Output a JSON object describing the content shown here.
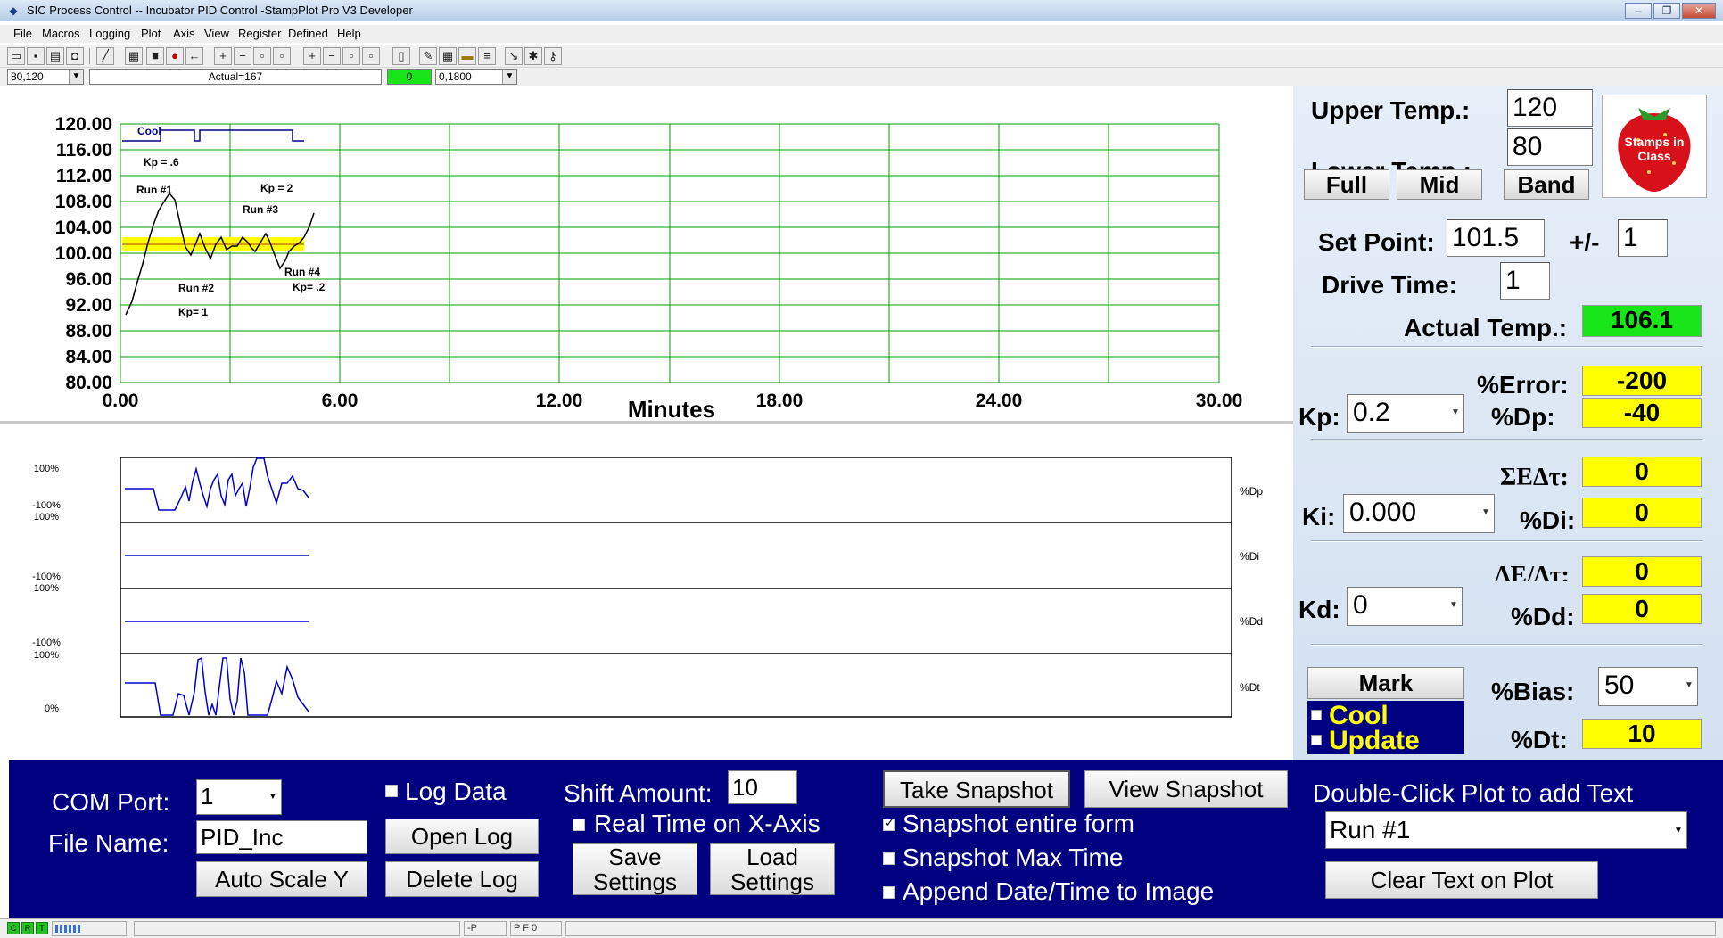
{
  "window": {
    "title": "SIC Process Control -- Incubator PID Control -StampPlot Pro V3 Developer",
    "controls": [
      "minimize",
      "restore",
      "close"
    ]
  },
  "menu": [
    "File",
    "Macros",
    "Logging",
    "Plot",
    "Axis",
    "View",
    "Register",
    "Defined",
    "Help"
  ],
  "toolbar": {
    "icons": [
      "open-icon",
      "save-icon",
      "print-icon",
      "camera-icon",
      "wand-icon",
      "bitmap-icon",
      "stop-icon",
      "record-icon",
      "back-arrow-icon",
      "plus-icon",
      "minus-icon",
      "box-icon",
      "box-icon",
      "plus-icon",
      "minus-icon",
      "box-icon",
      "box-icon",
      "document-icon",
      "pen-icon",
      "grid-icon",
      "note-icon",
      "list-icon",
      "tool-icon",
      "settings-icon"
    ]
  },
  "fieldrow": {
    "xy_combo": "80,120",
    "status_text": "Actual=167",
    "green_value": "0",
    "rate_combo": "0,1800"
  },
  "plot": {
    "x_axis_title": "Minutes",
    "x_ticks": [
      "0.00",
      "6.00",
      "12.00",
      "18.00",
      "24.00",
      "30.00"
    ],
    "y_ticks": [
      "120.00",
      "116.00",
      "112.00",
      "108.00",
      "104.00",
      "100.00",
      "96.00",
      "92.00",
      "88.00",
      "84.00",
      "80.00"
    ],
    "annotations": [
      "Cool",
      "Kp = .6",
      "Run #1",
      "Kp = 2",
      "Run #3",
      "Run #2",
      "Kp= 1",
      "Run #4",
      "Kp= .2"
    ]
  },
  "subplots": [
    {
      "label": "%Dp",
      "top": "100%",
      "bottom": "-100%"
    },
    {
      "label": "%Di",
      "top": "100%",
      "bottom": "-100%"
    },
    {
      "label": "%Dd",
      "top": "100%",
      "bottom": "-100%"
    },
    {
      "label": "%Dt",
      "top": "100%",
      "bottom": "0%"
    }
  ],
  "right_panel": {
    "upper_temp_label": "Upper Temp.:",
    "upper_temp_value": "120",
    "lower_temp_label": "Lower Temp.:",
    "lower_temp_value": "80",
    "logo_text": "Stamps in Class",
    "full_label": "Full",
    "mid_label": "Mid",
    "band_label": "Band",
    "set_point_label": "Set Point:",
    "set_point_value": "101.5",
    "plus_minus_label": "+/-",
    "plus_minus_value": "1",
    "drive_time_label": "Drive Time:",
    "drive_time_value": "1",
    "actual_temp_label": "Actual Temp.:",
    "actual_temp_value": "106.1",
    "error_label": "%Error:",
    "error_value": "-200",
    "kp_label": "Kp:",
    "kp_value": "0.2",
    "dp_label": "%Dp:",
    "dp_value": "-40",
    "sum_label": "ΣΕΔτ:",
    "sum_value": "0",
    "ki_label": "Ki:",
    "ki_value": "0.000",
    "di_label": "%Di:",
    "di_value": "0",
    "delta_label": "ΔΕ/Δτ:",
    "delta_value": "0",
    "kd_label": "Kd:",
    "kd_value": "0",
    "dd_label": "%Dd:",
    "dd_value": "0",
    "mark_label": "Mark",
    "bias_label": "%Bias:",
    "bias_value": "50",
    "cool_label": "Cool",
    "update_label": "Update",
    "dt_label": "%Dt:",
    "dt_value": "10"
  },
  "bottom_panel": {
    "com_port_label": "COM Port:",
    "com_port_value": "1",
    "file_name_label": "File Name:",
    "file_name_value": "PID_Inc",
    "auto_scale_label": "Auto Scale Y",
    "log_data_label": "Log Data",
    "open_log_label": "Open Log",
    "delete_log_label": "Delete Log",
    "shift_amount_label": "Shift Amount:",
    "shift_amount_value": "10",
    "real_time_label": "Real Time on X-Axis",
    "save_settings_label": "Save Settings",
    "load_settings_label": "Load Settings",
    "take_snapshot_label": "Take Snapshot",
    "view_snapshot_label": "View Snapshot",
    "snapshot_form_label": "Snapshot entire form",
    "snapshot_max_label": "Snapshot Max Time",
    "append_date_label": "Append Date/Time to Image",
    "double_click_label": "Double-Click Plot to add Text",
    "text_combo_value": "Run #1",
    "clear_text_label": "Clear Text on Plot"
  },
  "statusbar": {
    "leds": [
      "C",
      "R",
      "T"
    ],
    "panel_p": "-P",
    "panel_pf": "P F 0"
  }
}
